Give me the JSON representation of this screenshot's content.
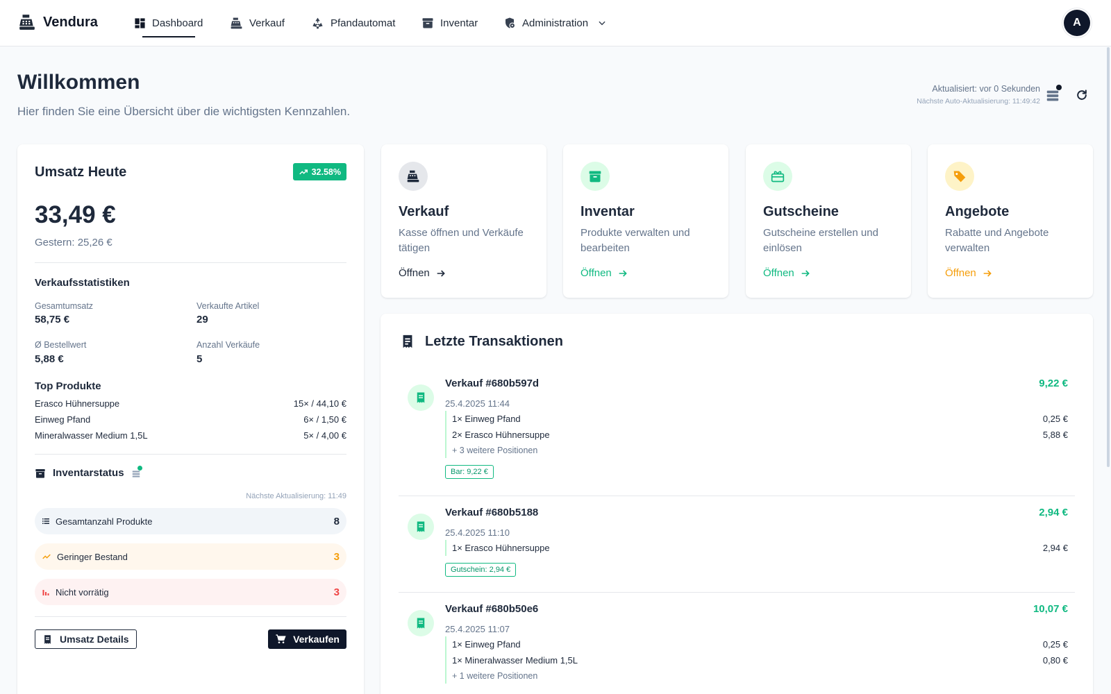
{
  "nav": {
    "brand": "Vendura",
    "items": [
      {
        "label": "Dashboard",
        "icon": "dashboard-icon"
      },
      {
        "label": "Verkauf",
        "icon": "cash-register-icon"
      },
      {
        "label": "Pfandautomat",
        "icon": "recycle-icon"
      },
      {
        "label": "Inventar",
        "icon": "archive-icon"
      },
      {
        "label": "Administration",
        "icon": "shield-gear-icon"
      }
    ],
    "avatar": "A"
  },
  "header": {
    "title": "Willkommen",
    "subtitle": "Hier finden Sie eine Übersicht über die wichtigsten Kennzahlen.",
    "updated": "Aktualisiert: vor 0 Sekunden",
    "next_update": "Nächste Auto-Aktualisierung: 11:49:42"
  },
  "sales": {
    "title": "Umsatz Heute",
    "trend": "32.58%",
    "amount": "33,49 €",
    "yesterday": "Gestern: 25,26 €",
    "stats_title": "Verkaufsstatistiken",
    "stats": [
      {
        "label": "Gesamtumsatz",
        "value": "58,75 €"
      },
      {
        "label": "Verkaufte Artikel",
        "value": "29"
      },
      {
        "label": "Ø Bestellwert",
        "value": "5,88 €"
      },
      {
        "label": "Anzahl Verkäufe",
        "value": "5"
      }
    ],
    "top_title": "Top Produkte",
    "top_products": [
      {
        "name": "Erasco Hühnersuppe",
        "value": "15× / 44,10 €"
      },
      {
        "name": "Einweg Pfand",
        "value": "6× / 1,50 €"
      },
      {
        "name": "Mineralwasser Medium 1,5L",
        "value": "5× / 4,00 €"
      }
    ],
    "inventory_title": "Inventarstatus",
    "inventory_next": "Nächste Aktualisierung: 11:49",
    "inventory": [
      {
        "label": "Gesamtanzahl Produkte",
        "value": "8",
        "color": "#1e293b",
        "bg": "#f1f5f9"
      },
      {
        "label": "Geringer Bestand",
        "value": "3",
        "color": "#f59e0b",
        "bg": "#fffbeb"
      },
      {
        "label": "Nicht vorrätig",
        "value": "3",
        "color": "#ef4444",
        "bg": "#fef2f2"
      }
    ],
    "btn_details": "Umsatz Details",
    "btn_sell": "Verkaufen"
  },
  "quick": [
    {
      "title": "Verkauf",
      "desc": "Kasse öffnen und Verkäufe tätigen",
      "link": "Öffnen",
      "color": "#1e293b",
      "bg": "#e5e7eb"
    },
    {
      "title": "Inventar",
      "desc": "Produkte verwalten und bearbeiten",
      "link": "Öffnen",
      "color": "#10b981",
      "bg": "#dcfce7"
    },
    {
      "title": "Gutscheine",
      "desc": "Gutscheine erstellen und einlösen",
      "link": "Öffnen",
      "color": "#10b981",
      "bg": "#dcfce7"
    },
    {
      "title": "Angebote",
      "desc": "Rabatte und Angebote verwalten",
      "link": "Öffnen",
      "color": "#f59e0b",
      "bg": "#fef3c7"
    }
  ],
  "transactions": {
    "title": "Letzte Transaktionen",
    "items": [
      {
        "id": "Verkauf #680b597d",
        "amount": "9,22 €",
        "date": "25.4.2025 11:44",
        "lines": [
          {
            "label": "1× Einweg Pfand",
            "value": "0,25 €"
          },
          {
            "label": "2× Erasco Hühnersuppe",
            "value": "5,88 €"
          }
        ],
        "more": "+ 3 weitere Positionen",
        "payment": "Bar: 9,22 €"
      },
      {
        "id": "Verkauf #680b5188",
        "amount": "2,94 €",
        "date": "25.4.2025 11:10",
        "lines": [
          {
            "label": "1× Erasco Hühnersuppe",
            "value": "2,94 €"
          }
        ],
        "more": "",
        "payment": "Gutschein: 2,94 €"
      },
      {
        "id": "Verkauf #680b50e6",
        "amount": "10,07 €",
        "date": "25.4.2025 11:07",
        "lines": [
          {
            "label": "1× Einweg Pfand",
            "value": "0,25 €"
          },
          {
            "label": "1× Mineralwasser Medium 1,5L",
            "value": "0,80 €"
          }
        ],
        "more": "+ 1 weitere Positionen",
        "payment": ""
      }
    ]
  }
}
